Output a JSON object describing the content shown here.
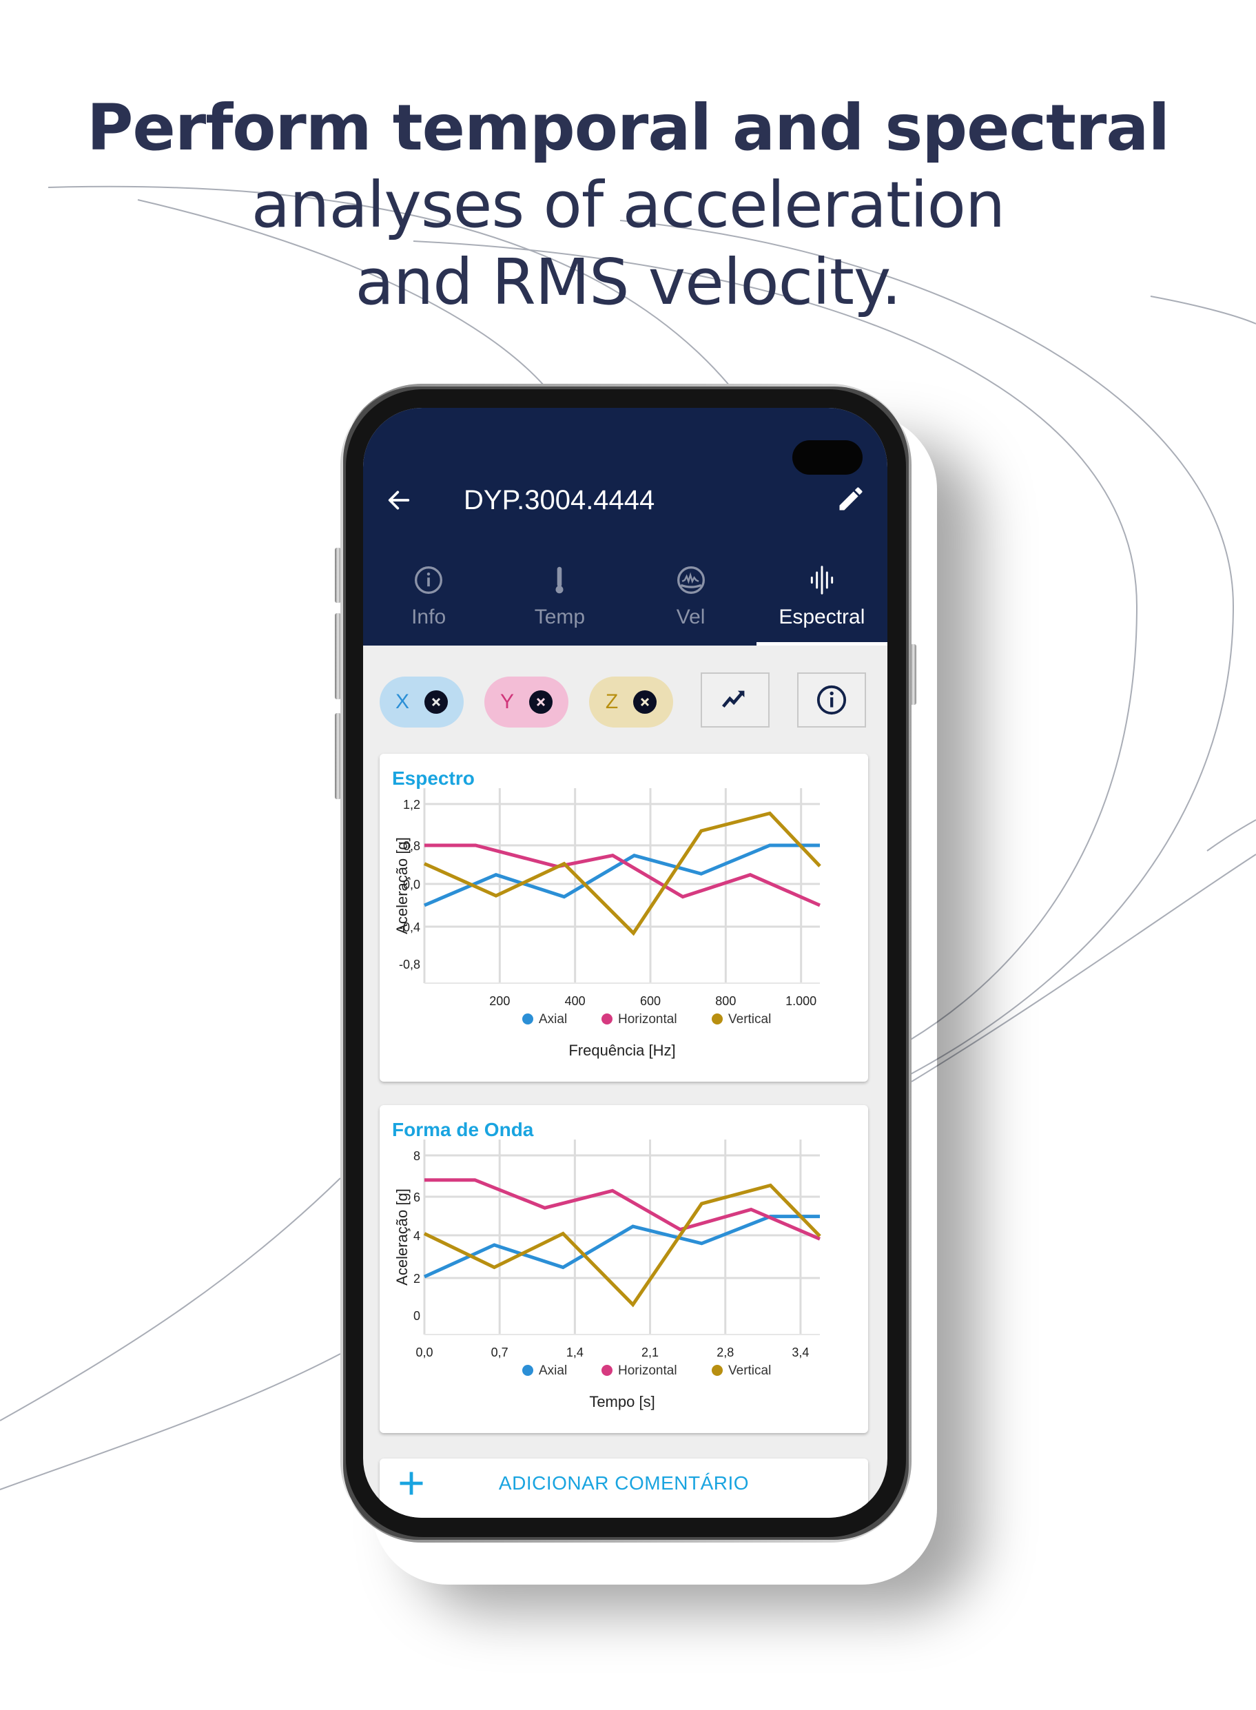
{
  "headline": {
    "line1": "Perform temporal and spectral",
    "line2": "analyses of acceleration",
    "line3": "and RMS velocity."
  },
  "app": {
    "title": "DYP.3004.4444",
    "back_icon": "arrow-left-icon",
    "edit_icon": "pencil-icon",
    "header_color": "#12224a",
    "accent_color": "#19a4e0",
    "tabs": [
      {
        "label": "Info",
        "icon": "info-circle-icon",
        "active": false
      },
      {
        "label": "Temp",
        "icon": "thermometer-icon",
        "active": false
      },
      {
        "label": "Vel",
        "icon": "velocity-gauge-icon",
        "active": false
      },
      {
        "label": "Espectral",
        "icon": "sound-wave-icon",
        "active": true
      }
    ],
    "axis_chips": [
      {
        "label": "X",
        "text_color": "#2b8fd6",
        "bg_color": "#bcdcf2",
        "remove_icon": "close-circle-icon"
      },
      {
        "label": "Y",
        "text_color": "#d0357a",
        "bg_color": "#f3bdd6",
        "remove_icon": "close-circle-icon"
      },
      {
        "label": "Z",
        "text_color": "#b88f10",
        "bg_color": "#ecdfb4",
        "remove_icon": "close-circle-icon"
      }
    ],
    "toolbar": {
      "trend_icon": "trending-up-icon",
      "info_icon": "info-circle-icon"
    },
    "comment_button": {
      "label": "ADICIONAR COMENTÁRIO",
      "icon": "plus-icon"
    }
  },
  "chart_data": [
    {
      "type": "line",
      "title": "Espectro",
      "xlabel": "Frequência [Hz]",
      "ylabel": "Aceleração [g]",
      "x_ticks": [
        "200",
        "400",
        "600",
        "800",
        "1.000"
      ],
      "x_tick_values": [
        200,
        400,
        600,
        800,
        1000
      ],
      "xlim": [
        0,
        1050
      ],
      "y_ticks": [
        "1,2",
        "0,8",
        "0,0",
        "-0,4",
        "-0,8"
      ],
      "y_tick_values": [
        1.2,
        0.8,
        0.0,
        -0.4,
        -0.8
      ],
      "grid": true,
      "legend": "bottom",
      "series": [
        {
          "name": "Axial",
          "color": "#2b8fd6",
          "x": [
            0,
            190,
            371,
            557,
            735,
            917,
            1050
          ],
          "y": [
            -0.2,
            0.19,
            -0.12,
            0.59,
            0.21,
            0.8,
            0.8
          ]
        },
        {
          "name": "Horizontal",
          "color": "#d63a80",
          "x": [
            0,
            136,
            353,
            500,
            686,
            865,
            1050
          ],
          "y": [
            0.8,
            0.8,
            0.36,
            0.59,
            -0.12,
            0.19,
            -0.2
          ]
        },
        {
          "name": "Vertical",
          "color": "#b88f10",
          "x": [
            0,
            190,
            371,
            555,
            735,
            917,
            1050
          ],
          "y": [
            0.42,
            -0.11,
            0.42,
            -0.47,
            0.94,
            1.11,
            0.37
          ]
        }
      ]
    },
    {
      "type": "line",
      "title": "Forma de Onda",
      "xlabel": "Tempo [s]",
      "ylabel": "Aceleração [g]",
      "x_ticks": [
        "0,0",
        "0,7",
        "1,4",
        "2,1",
        "2,8",
        "3,4"
      ],
      "x_tick_values": [
        0.0,
        0.7,
        1.4,
        2.1,
        2.8,
        3.5
      ],
      "xlim": [
        0,
        3.68
      ],
      "y_ticks": [
        "8",
        "6",
        "4",
        "2",
        "0"
      ],
      "y_tick_values": [
        8,
        6,
        4,
        2,
        0
      ],
      "grid": true,
      "legend": "bottom",
      "series": [
        {
          "name": "Axial",
          "color": "#2b8fd6",
          "x": [
            0.0,
            0.65,
            1.29,
            1.94,
            2.58,
            3.22,
            3.68
          ],
          "y": [
            2.06,
            3.55,
            2.5,
            4.46,
            3.62,
            4.98,
            4.98
          ]
        },
        {
          "name": "Horizontal",
          "color": "#d63a80",
          "x": [
            0.0,
            0.47,
            1.12,
            1.75,
            2.38,
            3.04,
            3.68
          ],
          "y": [
            6.81,
            6.81,
            5.42,
            6.29,
            4.3,
            5.34,
            3.83
          ]
        },
        {
          "name": "Vertical",
          "color": "#b88f10",
          "x": [
            0.0,
            0.65,
            1.29,
            1.94,
            2.58,
            3.22,
            3.68
          ],
          "y": [
            4.09,
            2.5,
            4.09,
            0.57,
            5.64,
            6.55,
            3.96
          ]
        }
      ]
    }
  ]
}
